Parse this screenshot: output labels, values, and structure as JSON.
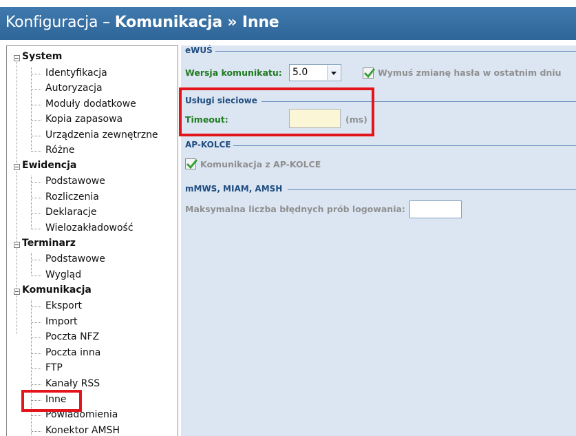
{
  "header": {
    "title_prefix": "Konfiguracja – ",
    "title_bold": "Komunikacja » Inne"
  },
  "tree": {
    "groups": [
      "System",
      "Ewidencja",
      "Terminarz",
      "Komunikacja"
    ],
    "system_items": [
      "Identyfikacja",
      "Autoryzacja",
      "Moduły dodatkowe",
      "Kopia zapasowa",
      "Urządzenia zewnętrzne",
      "Różne"
    ],
    "ewidencja_items": [
      "Podstawowe",
      "Rozliczenia",
      "Deklaracje",
      "Wielozakładowość"
    ],
    "terminarz_items": [
      "Podstawowe",
      "Wygląd"
    ],
    "komunikacja_items": [
      "Eksport",
      "Import",
      "Poczta NFZ",
      "Poczta inna",
      "FTP",
      "Kanały RSS",
      "Inne",
      "Powiadomienia",
      "Konektor AMSH"
    ]
  },
  "main": {
    "ewus": {
      "title": "eWUŚ",
      "version_label": "Wersja komunikatu:",
      "version_value": "5.0",
      "force_change_label": "Wymuś zmianę hasła w ostatnim dniu"
    },
    "network": {
      "title": "Usługi sieciowe",
      "timeout_label": "Timeout:",
      "timeout_value": "",
      "unit": "(ms)"
    },
    "apkolce": {
      "title": "AP-KOLCE",
      "comm_label": "Komunikacja z AP-KOLCE"
    },
    "mmws": {
      "title": "mMWS, MIAM, AMSH",
      "max_attempts_label": "Maksymalna liczba błędnych prób logowania:",
      "max_attempts_value": ""
    }
  },
  "colors": {
    "header": "#3368a0",
    "panel": "#dce6f3",
    "highlight": "#e3141c",
    "green_label": "#1f7a1f"
  }
}
